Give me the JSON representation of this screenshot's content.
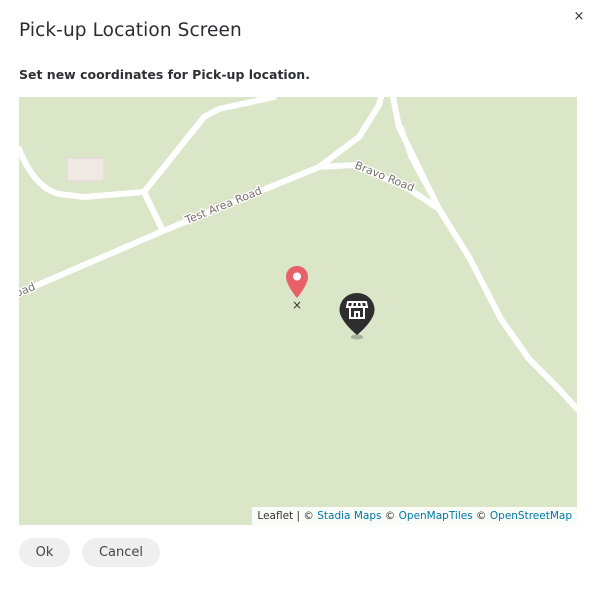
{
  "dialog": {
    "title": "Pick-up Location Screen",
    "subtitle": "Set new coordinates for Pick-up location.",
    "close_label": "×"
  },
  "map": {
    "roads": {
      "test_area": "Test Area Road",
      "bravo": "Bravo Road",
      "left_fragment": "oad"
    },
    "center_mark": "×",
    "attribution": {
      "leaflet": "Leaflet",
      "separator": " | © ",
      "stadia": "Stadia Maps",
      "copy1": " © ",
      "openmaptiles": "OpenMapTiles",
      "copy2": " © ",
      "osm": "OpenStreetMap"
    },
    "colors": {
      "land": "#dbe6c9",
      "road": "#ffffff",
      "pin": "#e8606a",
      "store_marker": "#2e2e2e"
    },
    "icons": {
      "pickup": "map-pin-icon",
      "store": "store-icon"
    }
  },
  "buttons": {
    "ok": "Ok",
    "cancel": "Cancel"
  }
}
